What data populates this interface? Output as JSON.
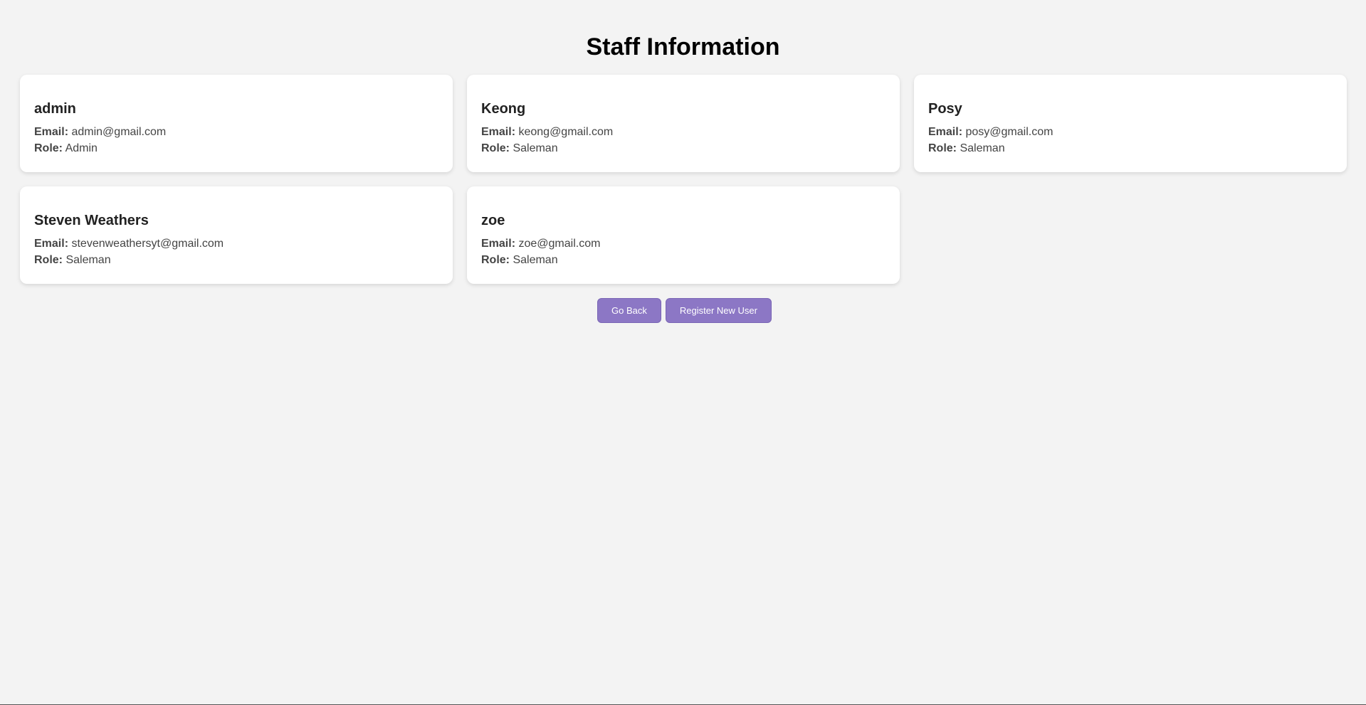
{
  "page": {
    "title": "Staff Information"
  },
  "labels": {
    "email": "Email:",
    "role": "Role:"
  },
  "staff": [
    {
      "name": "admin",
      "email": "admin@gmail.com",
      "role": "Admin"
    },
    {
      "name": "Keong",
      "email": "keong@gmail.com",
      "role": "Saleman"
    },
    {
      "name": "Posy",
      "email": "posy@gmail.com",
      "role": "Saleman"
    },
    {
      "name": "Steven Weathers",
      "email": "stevenweathersyt@gmail.com",
      "role": "Saleman"
    },
    {
      "name": "zoe",
      "email": "zoe@gmail.com",
      "role": "Saleman"
    }
  ],
  "actions": {
    "go_back": "Go Back",
    "register": "Register New User"
  },
  "colors": {
    "background": "#f3f3f3",
    "card": "#ffffff",
    "button": "#8c77c5"
  }
}
